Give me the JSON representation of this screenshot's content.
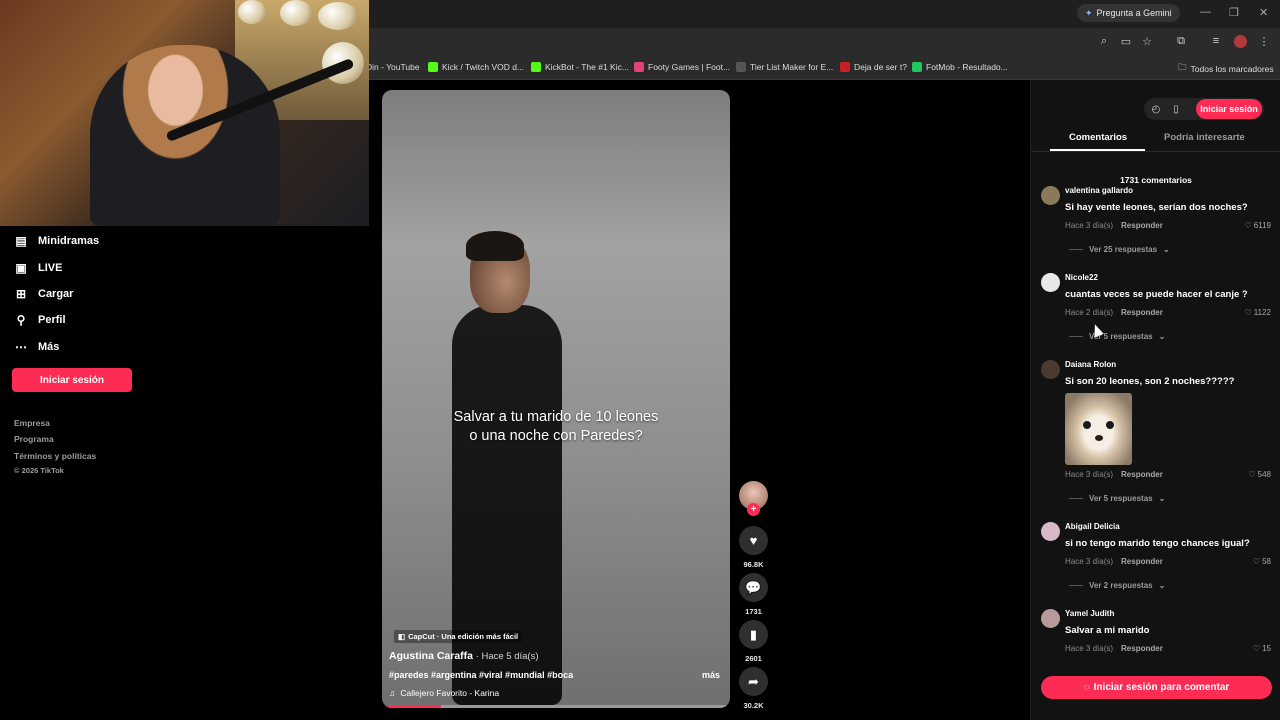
{
  "browser": {
    "gemini_label": "Pregunta a Gemini",
    "bookmarks": [
      {
        "label": "Din - YouTube",
        "color": "#ff0000"
      },
      {
        "label": "Kick / Twitch VOD d...",
        "color": "#53fc18"
      },
      {
        "label": "KickBot - The #1 Kic...",
        "color": "#53fc18"
      },
      {
        "label": "Footy Games | Foot...",
        "color": "#e0427a"
      },
      {
        "label": "Tier List Maker for E...",
        "color": "#333333"
      },
      {
        "label": "Deja de ser t?",
        "color": "#c82020"
      },
      {
        "label": "FotMob - Resultado...",
        "color": "#22c55e"
      }
    ],
    "all_bookmarks": "Todos los marcadores"
  },
  "sidebar": {
    "items": [
      {
        "label": "Minidramas",
        "icon": "minidramas-icon"
      },
      {
        "label": "LIVE",
        "icon": "live-icon"
      },
      {
        "label": "Cargar",
        "icon": "upload-icon"
      },
      {
        "label": "Perfil",
        "icon": "profile-icon"
      },
      {
        "label": "Más",
        "icon": "more-icon"
      }
    ],
    "login_label": "Iniciar sesión",
    "footer": [
      "Empresa",
      "Programa",
      "Términos y políticas",
      "© 2026 TikTok"
    ]
  },
  "video": {
    "caption_line1": "Salvar a tu marido de 10 leones",
    "caption_line2": "o una noche con Paredes?",
    "capcut": "CapCut · Una edición más fácil",
    "author": "Agustina  Caraffa",
    "time": " · Hace 5 día(s)",
    "hashtags": "#paredes #argentina #viral #mundial #boca",
    "more": "más",
    "music": "Callejero Favorito - Karina",
    "progress": 0.17
  },
  "actions": {
    "likes": "96.8K",
    "comments": "1731",
    "saves": "2601",
    "shares": "30.2K"
  },
  "panel": {
    "login_label": "Iniciar sesión",
    "tab_comments": "Comentarios",
    "tab_interest": "Podría interesarte",
    "comments_count": "1731 comentarios",
    "reply_label": "Responder",
    "comments": [
      {
        "user": "valentina gallardo",
        "text": "Si hay vente leones, serían dos noches?",
        "time": "Hace 3 día(s)",
        "likes": "6119",
        "replies": "Ver 25 respuestas",
        "avatar": "#8a7a5a"
      },
      {
        "user": "Nicole22",
        "text": "cuantas veces se puede hacer el canje ?",
        "time": "Hace 2 día(s)",
        "likes": "1122",
        "replies": "Ver 5 respuestas",
        "avatar": "#e8e8e8"
      },
      {
        "user": "Daiana Rolon",
        "text": "Si son 20 leones, son 2 noches?????",
        "time": "Hace 3 día(s)",
        "likes": "548",
        "replies": "Ver 5 respuestas",
        "avatar": "#4a3a30"
      },
      {
        "user": "Abigail Delicia",
        "text": "si no tengo marido tengo chances igual?",
        "time": "Hace 3 día(s)",
        "likes": "58",
        "replies": "Ver 2 respuestas",
        "avatar": "#d6b8c8"
      },
      {
        "user": "Yamel Judith",
        "text": "Salvar a mi marido",
        "time": "Hace 3 día(s)",
        "likes": "15",
        "avatar": "#b89a9a"
      }
    ],
    "comment_login": "Iniciar sesión para comentar"
  }
}
